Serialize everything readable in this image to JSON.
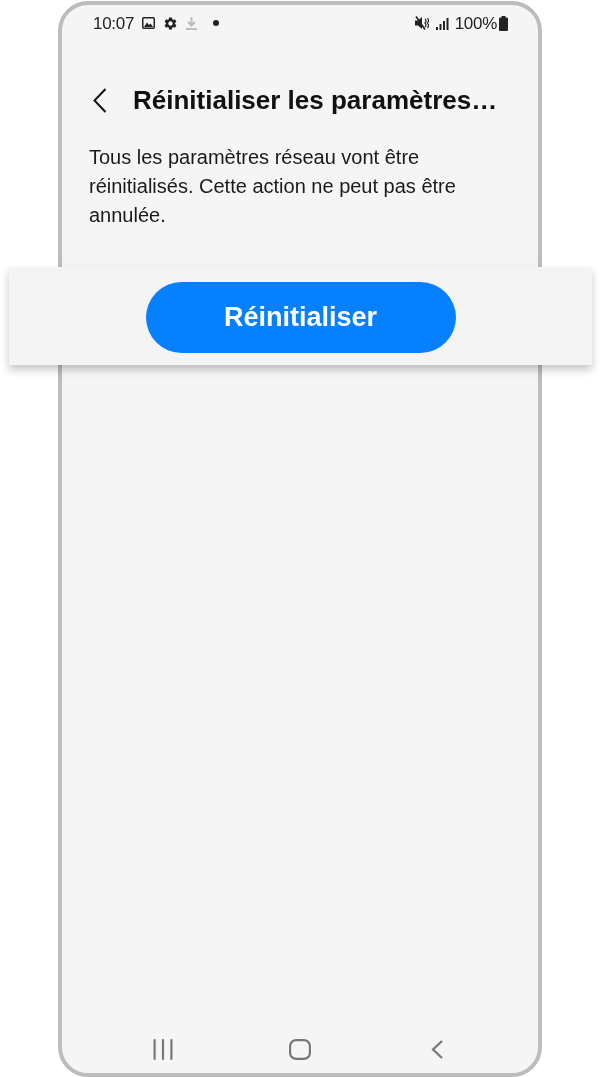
{
  "status_bar": {
    "time": "10:07",
    "battery": "100%"
  },
  "header": {
    "title": "Réinitialiser les paramètres…"
  },
  "description": "Tous les paramètres réseau vont être réinitialisés. Cette action ne peut pas être annulée.",
  "action": {
    "label": "Réinitialiser"
  }
}
